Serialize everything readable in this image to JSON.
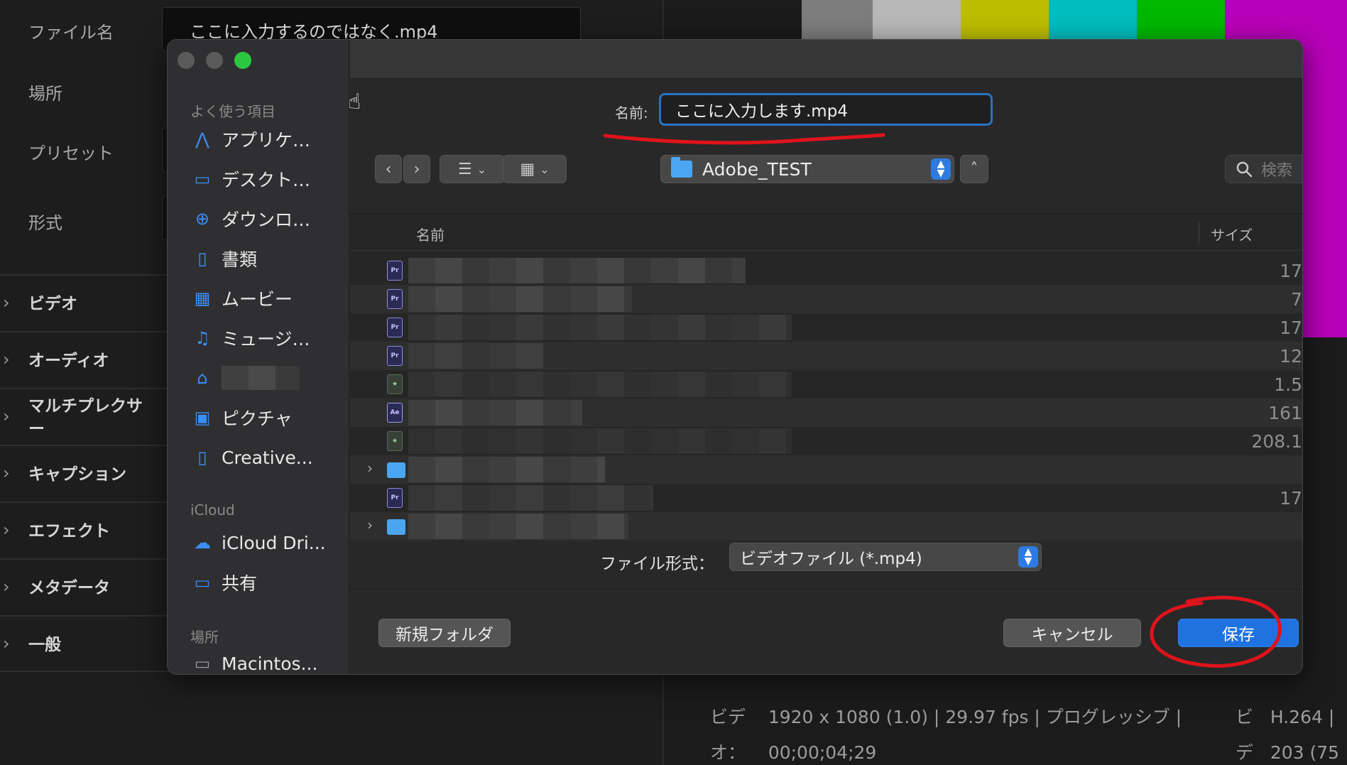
{
  "background": {
    "filename_label": "ファイル名",
    "filename_value": "ここに入力するのではなく.mp4",
    "location_label": "場所",
    "preset_label": "プリセット",
    "format_label": "形式",
    "sections": [
      "ビデオ",
      "オーディオ",
      "マルチプレクサー",
      "キャプション",
      "エフェクト",
      "メタデータ",
      "一般"
    ],
    "color_bars": [
      "#7d7d7d",
      "#b8b8b8",
      "#bdbd00",
      "#00bdbd",
      "#00b800",
      "#b800b8"
    ],
    "video_label": "ビデ",
    "video_label2": "オ：",
    "video_info": "1920 x 1080 (1.0) | 29.97 fps | プログレッシブ |",
    "video_timecode": "00;00;04;29",
    "right_label1": "ビ",
    "right_label2": "デ",
    "right_value1": "H.264 |",
    "right_value2": "203 (75"
  },
  "dialog": {
    "sidebar": {
      "favorites_header": "よく使う項目",
      "favorites": [
        {
          "icon": "applications-icon",
          "glyph": "⋀",
          "label": "アプリケ…"
        },
        {
          "icon": "desktop-icon",
          "glyph": "▭",
          "label": "デスクト…"
        },
        {
          "icon": "downloads-icon",
          "glyph": "⊕",
          "label": "ダウンロ…"
        },
        {
          "icon": "documents-icon",
          "glyph": "▯",
          "label": "書類"
        },
        {
          "icon": "movies-icon",
          "glyph": "▦",
          "label": "ムービー"
        },
        {
          "icon": "music-icon",
          "glyph": "♫",
          "label": "ミュージ…"
        },
        {
          "icon": "home-icon",
          "glyph": "⌂",
          "label": ""
        },
        {
          "icon": "pictures-icon",
          "glyph": "▣",
          "label": "ピクチャ"
        },
        {
          "icon": "creative-cloud-icon",
          "glyph": "▯",
          "label": "Creative..."
        }
      ],
      "icloud_header": "iCloud",
      "icloud": [
        {
          "icon": "icloud-drive-icon",
          "glyph": "☁",
          "label": "iCloud Dri..."
        },
        {
          "icon": "shared-folder-icon",
          "glyph": "▭",
          "label": "共有"
        }
      ],
      "locations_header": "場所",
      "locations": [
        {
          "icon": "disk-icon",
          "glyph": "▭",
          "label": "Macintos..."
        }
      ]
    },
    "name_label": "名前:",
    "name_value": "ここに入力します.mp4",
    "folder_name": "Adobe_TEST",
    "search_placeholder": "検索",
    "columns": {
      "name": "名前",
      "size": "サイズ"
    },
    "files": [
      {
        "type": "pr",
        "icon_text": "Pr",
        "size": "17",
        "alt": false
      },
      {
        "type": "pr",
        "icon_text": "Pr",
        "size": "7",
        "alt": true
      },
      {
        "type": "pr",
        "icon_text": "Pr",
        "size": "17",
        "alt": false
      },
      {
        "type": "pr",
        "icon_text": "Pr",
        "size": "12",
        "alt": true
      },
      {
        "type": "img",
        "icon_text": "★",
        "size": "1.5",
        "alt": false
      },
      {
        "type": "ae",
        "icon_text": "Ae",
        "size": "161",
        "alt": true
      },
      {
        "type": "img",
        "icon_text": "★",
        "size": "208.1",
        "alt": false
      },
      {
        "type": "folder",
        "icon_text": "",
        "size": "",
        "alt": true
      },
      {
        "type": "pr",
        "icon_text": "Pr",
        "size": "17",
        "alt": false
      },
      {
        "type": "folder",
        "icon_text": "",
        "size": "",
        "alt": true
      }
    ],
    "format_label": "ファイル形式：",
    "format_value": "ビデオファイル (*.mp4)",
    "new_folder": "新規フォルダ",
    "cancel": "キャンセル",
    "save": "保存"
  }
}
